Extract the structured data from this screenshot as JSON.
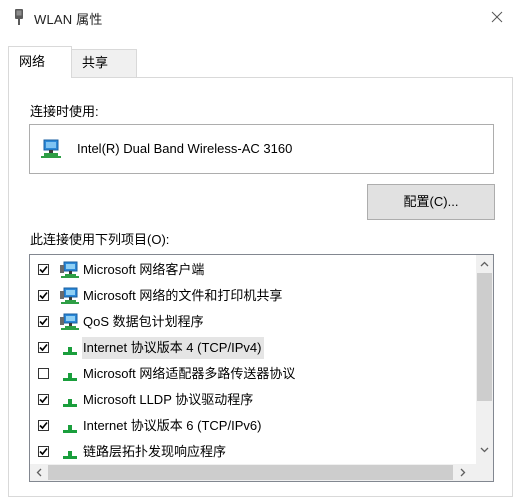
{
  "window": {
    "title": "WLAN 属性",
    "icon": "wifi-adapter-icon"
  },
  "tabs": [
    {
      "label": "网络",
      "active": true
    },
    {
      "label": "共享",
      "active": false
    }
  ],
  "connect_using": {
    "label": "连接时使用:",
    "adapter": "Intel(R) Dual Band Wireless-AC 3160"
  },
  "configure_button": "配置(C)...",
  "items_label": "此连接使用下列项目(O):",
  "items": [
    {
      "label": "Microsoft 网络客户端",
      "checked": true,
      "icon": "network-client-icon"
    },
    {
      "label": "Microsoft 网络的文件和打印机共享",
      "checked": true,
      "icon": "network-client-icon"
    },
    {
      "label": "QoS 数据包计划程序",
      "checked": true,
      "icon": "network-client-icon"
    },
    {
      "label": "Internet 协议版本 4 (TCP/IPv4)",
      "checked": true,
      "icon": "protocol-icon",
      "selected": true
    },
    {
      "label": "Microsoft 网络适配器多路传送器协议",
      "checked": false,
      "icon": "protocol-icon"
    },
    {
      "label": "Microsoft LLDP 协议驱动程序",
      "checked": true,
      "icon": "protocol-icon"
    },
    {
      "label": "Internet 协议版本 6 (TCP/IPv6)",
      "checked": true,
      "icon": "protocol-icon"
    },
    {
      "label": "链路层拓扑发现响应程序",
      "checked": true,
      "icon": "protocol-icon"
    }
  ],
  "colors": {
    "accent": "#0078d7",
    "protocol_green": "#1a9e3c"
  }
}
